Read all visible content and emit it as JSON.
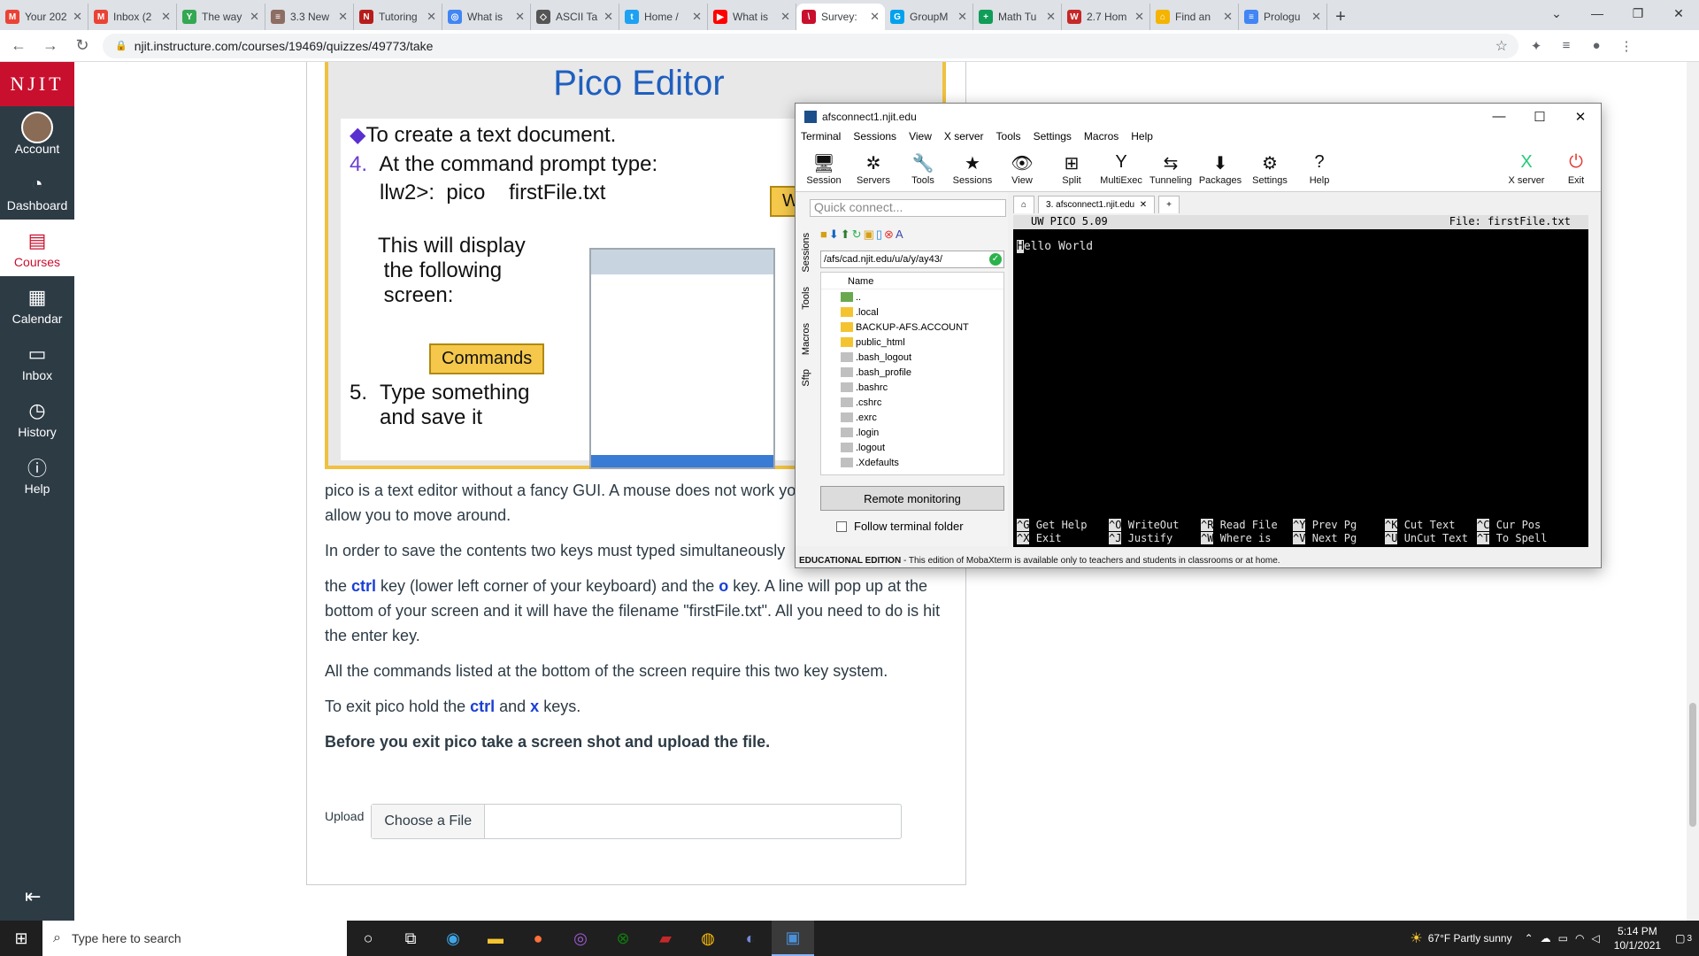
{
  "browser": {
    "tabs": [
      {
        "label": "Your 202",
        "color": "#ea4335",
        "glyph": "M"
      },
      {
        "label": "Inbox (2",
        "color": "#ea4335",
        "glyph": "M"
      },
      {
        "label": "The way",
        "color": "#34a853",
        "glyph": "Y"
      },
      {
        "label": "3.3 New",
        "color": "#8d6e63",
        "glyph": "≡"
      },
      {
        "label": "Tutoring",
        "color": "#b71c1c",
        "glyph": "N"
      },
      {
        "label": "What is",
        "color": "#4285f4",
        "glyph": "◎"
      },
      {
        "label": "ASCII Ta",
        "color": "#555555",
        "glyph": "◇"
      },
      {
        "label": "Home /",
        "color": "#1da1f2",
        "glyph": "t"
      },
      {
        "label": "What is",
        "color": "#ff0000",
        "glyph": "▶"
      },
      {
        "label": "Survey:",
        "color": "#c8102e",
        "glyph": "\\"
      },
      {
        "label": "GroupM",
        "color": "#00a2ed",
        "glyph": "G"
      },
      {
        "label": "Math Tu",
        "color": "#0f9d58",
        "glyph": "+"
      },
      {
        "label": "2.7 Hom",
        "color": "#c62828",
        "glyph": "W"
      },
      {
        "label": "Find an",
        "color": "#f4b400",
        "glyph": "⌂"
      },
      {
        "label": "Prologu",
        "color": "#4285f4",
        "glyph": "≡"
      }
    ],
    "active_tab_index": 9,
    "url": "njit.instructure.com/courses/19469/quizzes/49773/take"
  },
  "canvas_nav": {
    "logo": "NJIT",
    "items": [
      {
        "label": "Account",
        "icon": "avatar"
      },
      {
        "label": "Dashboard",
        "icon": "dashboard-icon"
      },
      {
        "label": "Courses",
        "icon": "courses-icon"
      },
      {
        "label": "Calendar",
        "icon": "calendar-icon"
      },
      {
        "label": "Inbox",
        "icon": "inbox-icon"
      },
      {
        "label": "History",
        "icon": "history-icon"
      },
      {
        "label": "Help",
        "icon": "help-icon"
      }
    ]
  },
  "slide": {
    "title": "Pico Editor",
    "bullet": "To create a text document.",
    "step4_num": "4.",
    "step4_text": "At the command prompt type:",
    "command": "llw2>:  pico    firstFile.txt",
    "display_text": "This will display\n the following\n screen:",
    "step5_num": "5.",
    "step5_text": "Type something\nand save it",
    "callout_when": "Whe",
    "callout_commands": "Commands"
  },
  "content": {
    "p1": "pico is a text editor without a fancy GUI.  A mouse does not work your keyboard will allow you to move around.",
    "p2": "In order to save the contents two keys must typed simultaneously",
    "p3_a": "the ",
    "p3_ctrl": "ctrl",
    "p3_b": " key (lower left corner of your keyboard) and the ",
    "p3_o": "o",
    "p3_c": " key. A line will pop up at the bottom of your screen and it will have the filename \"firstFile.txt\". All you need to do is hit the enter key.",
    "p4": "All the commands listed at the bottom of the screen require this two key system.",
    "p5_a": "To exit pico hold the ",
    "p5_ctrl": "ctrl",
    "p5_b": " and ",
    "p5_x": "x",
    "p5_c": " keys.",
    "p6": "Before you exit pico take a screen shot and upload the file.",
    "upload_label": "Upload",
    "upload_button": "Choose a File"
  },
  "moba": {
    "title": "afsconnect1.njit.edu",
    "menu": [
      "Terminal",
      "Sessions",
      "View",
      "X server",
      "Tools",
      "Settings",
      "Macros",
      "Help"
    ],
    "toolbar": [
      {
        "label": "Session",
        "icon": "🖥"
      },
      {
        "label": "Servers",
        "icon": "✲"
      },
      {
        "label": "Tools",
        "icon": "🔧"
      },
      {
        "label": "Sessions",
        "icon": "★"
      },
      {
        "label": "View",
        "icon": "👁"
      },
      {
        "label": "Split",
        "icon": "⊞"
      },
      {
        "label": "MultiExec",
        "icon": "Y"
      },
      {
        "label": "Tunneling",
        "icon": "⇆"
      },
      {
        "label": "Packages",
        "icon": "⬇"
      },
      {
        "label": "Settings",
        "icon": "⚙"
      },
      {
        "label": "Help",
        "icon": "?"
      }
    ],
    "xserver_label": "X server",
    "exit_label": "Exit",
    "quick_connect_placeholder": "Quick connect...",
    "side_tabs": [
      "Sessions",
      "Tools",
      "Macros",
      "Sftp"
    ],
    "path": "/afs/cad.njit.edu/u/a/y/ay43/",
    "tree_header": "Name",
    "files": [
      {
        "name": "..",
        "type": "up"
      },
      {
        "name": ".local",
        "type": "folder"
      },
      {
        "name": "BACKUP-AFS.ACCOUNT",
        "type": "folder"
      },
      {
        "name": "public_html",
        "type": "folder"
      },
      {
        "name": ".bash_logout",
        "type": "file"
      },
      {
        "name": ".bash_profile",
        "type": "file"
      },
      {
        "name": ".bashrc",
        "type": "file"
      },
      {
        "name": ".cshrc",
        "type": "file"
      },
      {
        "name": ".exrc",
        "type": "file"
      },
      {
        "name": ".login",
        "type": "file"
      },
      {
        "name": ".logout",
        "type": "file"
      },
      {
        "name": ".Xdefaults",
        "type": "file"
      }
    ],
    "remote_monitoring": "Remote monitoring",
    "follow_folder": "Follow terminal folder",
    "session_tab": "3. afsconnect1.njit.edu",
    "term_header_left": "UW PICO 5.09",
    "term_header_right": "File: firstFile.txt",
    "term_cursor_char": "H",
    "term_text": "ello World",
    "term_cmds": [
      {
        "k": "^G",
        "t": "Get Help"
      },
      {
        "k": "^O",
        "t": "WriteOut"
      },
      {
        "k": "^R",
        "t": "Read File"
      },
      {
        "k": "^Y",
        "t": "Prev Pg"
      },
      {
        "k": "^K",
        "t": "Cut Text"
      },
      {
        "k": "^C",
        "t": "Cur Pos"
      },
      {
        "k": "^X",
        "t": "Exit"
      },
      {
        "k": "^J",
        "t": "Justify"
      },
      {
        "k": "^W",
        "t": "Where is"
      },
      {
        "k": "^V",
        "t": "Next Pg"
      },
      {
        "k": "^U",
        "t": "UnCut Text"
      },
      {
        "k": "^T",
        "t": "To Spell"
      }
    ],
    "edu_bold": "EDUCATIONAL EDITION",
    "edu_text": " -  This edition of MobaXterm is available only to teachers and students in classrooms or at home."
  },
  "taskbar": {
    "search_placeholder": "Type here to search",
    "weather": "67°F  Partly sunny",
    "time": "5:14 PM",
    "date": "10/1/2021",
    "notifications": "3"
  }
}
